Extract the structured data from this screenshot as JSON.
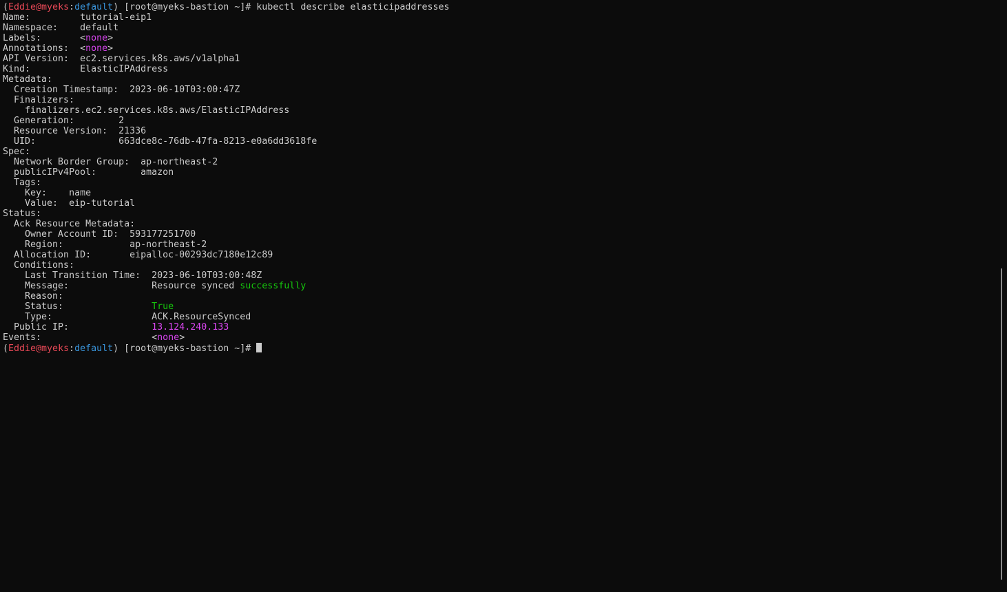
{
  "colors": {
    "background": "#0c0c0c",
    "text": "#cccccc",
    "user": "#e74856",
    "namespace": "#3a96dd",
    "none_value": "#d946ef",
    "success": "#16c60c",
    "ip": "#d946ef"
  },
  "terminal": {
    "lines": [
      [
        {
          "t": "(",
          "c": "dim"
        },
        {
          "t": "Eddie@myeks",
          "c": "red"
        },
        {
          "t": ":",
          "c": "dim"
        },
        {
          "t": "default",
          "c": "blue"
        },
        {
          "t": ") [root@myeks-bastion ~]# kubectl describe elasticipaddresses",
          "c": "dim"
        }
      ],
      [
        {
          "t": "Name:         tutorial-eip1",
          "c": "dim"
        }
      ],
      [
        {
          "t": "Namespace:    default",
          "c": "dim"
        }
      ],
      [
        {
          "t": "Labels:       <",
          "c": "dim"
        },
        {
          "t": "none",
          "c": "magenta"
        },
        {
          "t": ">",
          "c": "dim"
        }
      ],
      [
        {
          "t": "Annotations:  <",
          "c": "dim"
        },
        {
          "t": "none",
          "c": "magenta"
        },
        {
          "t": ">",
          "c": "dim"
        }
      ],
      [
        {
          "t": "API Version:  ec2.services.k8s.aws/v1alpha1",
          "c": "dim"
        }
      ],
      [
        {
          "t": "Kind:         ElasticIPAddress",
          "c": "dim"
        }
      ],
      [
        {
          "t": "Metadata:",
          "c": "dim"
        }
      ],
      [
        {
          "t": "  Creation Timestamp:  2023-06-10T03:00:47Z",
          "c": "dim"
        }
      ],
      [
        {
          "t": "  Finalizers:",
          "c": "dim"
        }
      ],
      [
        {
          "t": "    finalizers.ec2.services.k8s.aws/ElasticIPAddress",
          "c": "dim"
        }
      ],
      [
        {
          "t": "  Generation:        2",
          "c": "dim"
        }
      ],
      [
        {
          "t": "  Resource Version:  21336",
          "c": "dim"
        }
      ],
      [
        {
          "t": "  UID:               663dce8c-76db-47fa-8213-e0a6dd3618fe",
          "c": "dim"
        }
      ],
      [
        {
          "t": "Spec:",
          "c": "dim"
        }
      ],
      [
        {
          "t": "  Network Border Group:  ap-northeast-2",
          "c": "dim"
        }
      ],
      [
        {
          "t": "  publicIPv4Pool:        amazon",
          "c": "dim"
        }
      ],
      [
        {
          "t": "  Tags:",
          "c": "dim"
        }
      ],
      [
        {
          "t": "    Key:    name",
          "c": "dim"
        }
      ],
      [
        {
          "t": "    Value:  eip-tutorial",
          "c": "dim"
        }
      ],
      [
        {
          "t": "Status:",
          "c": "dim"
        }
      ],
      [
        {
          "t": "  Ack Resource Metadata:",
          "c": "dim"
        }
      ],
      [
        {
          "t": "    Owner Account ID:  593177251700",
          "c": "dim"
        }
      ],
      [
        {
          "t": "    Region:            ap-northeast-2",
          "c": "dim"
        }
      ],
      [
        {
          "t": "  Allocation ID:       eipalloc-00293dc7180e12c89",
          "c": "dim"
        }
      ],
      [
        {
          "t": "  Conditions:",
          "c": "dim"
        }
      ],
      [
        {
          "t": "    Last Transition Time:  2023-06-10T03:00:48Z",
          "c": "dim"
        }
      ],
      [
        {
          "t": "    Message:               Resource synced ",
          "c": "dim"
        },
        {
          "t": "successfully",
          "c": "green"
        }
      ],
      [
        {
          "t": "    Reason:",
          "c": "dim"
        }
      ],
      [
        {
          "t": "    Status:                ",
          "c": "dim"
        },
        {
          "t": "True",
          "c": "green"
        }
      ],
      [
        {
          "t": "    Type:                  ACK.ResourceSynced",
          "c": "dim"
        }
      ],
      [
        {
          "t": "  Public IP:               ",
          "c": "dim"
        },
        {
          "t": "13.124.240.133",
          "c": "magenta"
        }
      ],
      [
        {
          "t": "Events:                    <",
          "c": "dim"
        },
        {
          "t": "none",
          "c": "magenta"
        },
        {
          "t": ">",
          "c": "dim"
        }
      ],
      [
        {
          "t": "(",
          "c": "dim"
        },
        {
          "t": "Eddie@myeks",
          "c": "red"
        },
        {
          "t": ":",
          "c": "dim"
        },
        {
          "t": "default",
          "c": "blue"
        },
        {
          "t": ") [root@myeks-bastion ~]# ",
          "c": "dim"
        }
      ]
    ]
  }
}
